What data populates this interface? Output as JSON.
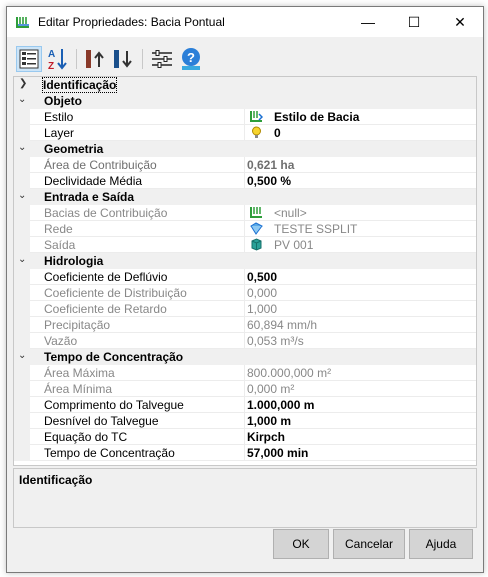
{
  "window": {
    "title": "Editar Propriedades: Bacia Pontual",
    "minimize": "—",
    "maximize": "☐",
    "close": "✕"
  },
  "toolbar": {
    "items": [
      "categorized-view-icon",
      "alphabetical-sort-icon",
      "move-up-icon",
      "move-down-icon",
      "settings-sliders-icon",
      "help-icon"
    ]
  },
  "grid": {
    "identificacao_label": "Identificação",
    "categories": {
      "objeto": "Objeto",
      "geometria": "Geometria",
      "entrada": "Entrada e Saída",
      "hidrologia": "Hidrologia",
      "tempo": "Tempo de Concentração"
    },
    "rows": {
      "estilo": {
        "label": "Estilo",
        "value": "Estilo de Bacia"
      },
      "layer": {
        "label": "Layer",
        "value": "0"
      },
      "area": {
        "label": "Área de Contribuição",
        "value": "0,621 ha"
      },
      "decl": {
        "label": "Declividade Média",
        "value": "0,500 %"
      },
      "bacias": {
        "label": "Bacias de Contribuição",
        "value": "<null>"
      },
      "rede": {
        "label": "Rede",
        "value": "TESTE SSPLIT"
      },
      "saida": {
        "label": "Saída",
        "value": "PV 001"
      },
      "coefdef": {
        "label": "Coeficiente de Deflúvio",
        "value": "0,500"
      },
      "coefdist": {
        "label": "Coeficiente de Distribuição",
        "value": "0,000"
      },
      "coefret": {
        "label": "Coeficiente de Retardo",
        "value": "1,000"
      },
      "precip": {
        "label": "Precipitação",
        "value": "60,894 mm/h"
      },
      "vazao": {
        "label": "Vazão",
        "value": "0,053 m³/s"
      },
      "areamax": {
        "label": "Área Máxima",
        "value": "800.000,000 m²"
      },
      "areamin": {
        "label": "Área Mínima",
        "value": "0,000 m²"
      },
      "comp": {
        "label": "Comprimento do Talvegue",
        "value": "1.000,000 m"
      },
      "desnivel": {
        "label": "Desnível do Talvegue",
        "value": "1,000 m"
      },
      "equacao": {
        "label": "Equação do TC",
        "value": "Kirpch"
      },
      "tc": {
        "label": "Tempo de Concentração",
        "value": "57,000 min"
      }
    }
  },
  "description": {
    "title": "Identificação"
  },
  "buttons": {
    "ok": "OK",
    "cancel": "Cancelar",
    "help": "Ajuda"
  }
}
